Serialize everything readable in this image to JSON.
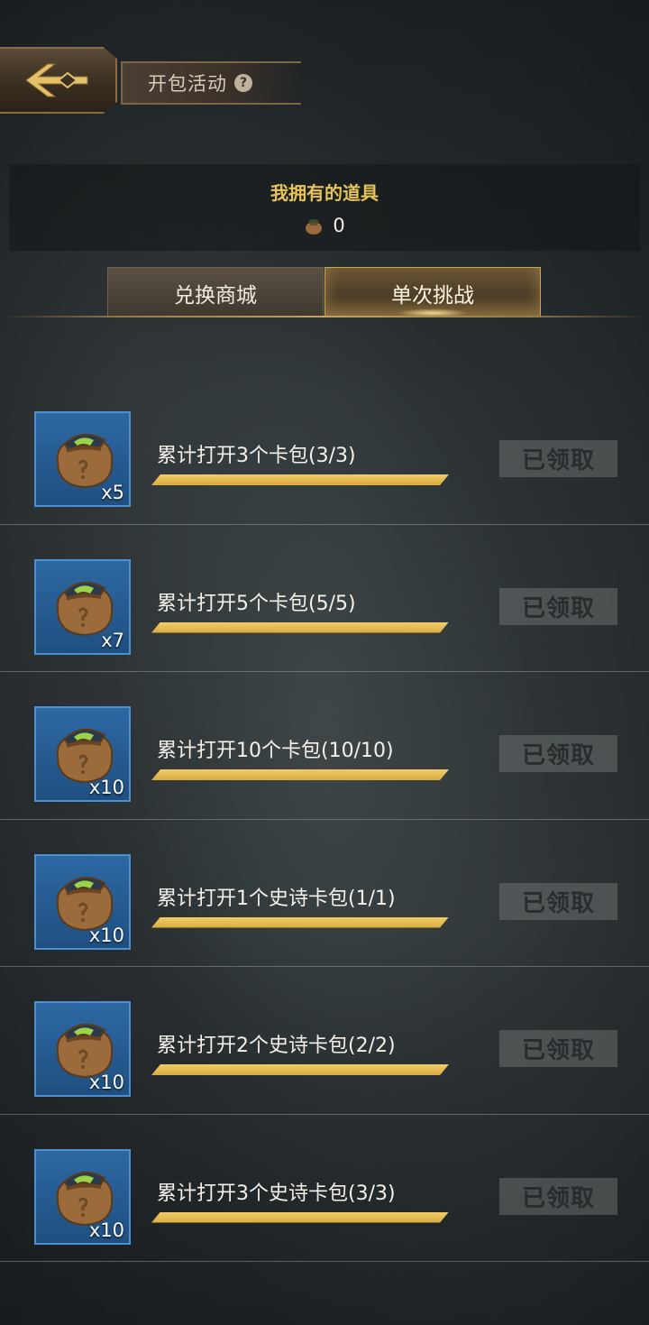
{
  "header": {
    "title": "开包活动",
    "help_glyph": "?"
  },
  "inventory": {
    "title": "我拥有的道具",
    "count": "0",
    "icon": "card-pack-bag-icon"
  },
  "tabs": [
    {
      "label": "兑换商城",
      "active": false
    },
    {
      "label": "单次挑战",
      "active": true
    }
  ],
  "colors": {
    "accent_gold": "#e7c45a",
    "progress_gold": "#d9ab3e",
    "reward_blue": "#2d68a3"
  },
  "tasks": [
    {
      "label": "累计打开3个卡包(3/3)",
      "reward_qty": "x5",
      "progress": 1.0,
      "button": "已领取"
    },
    {
      "label": "累计打开5个卡包(5/5)",
      "reward_qty": "x7",
      "progress": 1.0,
      "button": "已领取"
    },
    {
      "label": "累计打开10个卡包(10/10)",
      "reward_qty": "x10",
      "progress": 1.0,
      "button": "已领取"
    },
    {
      "label": "累计打开1个史诗卡包(1/1)",
      "reward_qty": "x10",
      "progress": 1.0,
      "button": "已领取"
    },
    {
      "label": "累计打开2个史诗卡包(2/2)",
      "reward_qty": "x10",
      "progress": 1.0,
      "button": "已领取"
    },
    {
      "label": "累计打开3个史诗卡包(3/3)",
      "reward_qty": "x10",
      "progress": 1.0,
      "button": "已领取"
    }
  ]
}
